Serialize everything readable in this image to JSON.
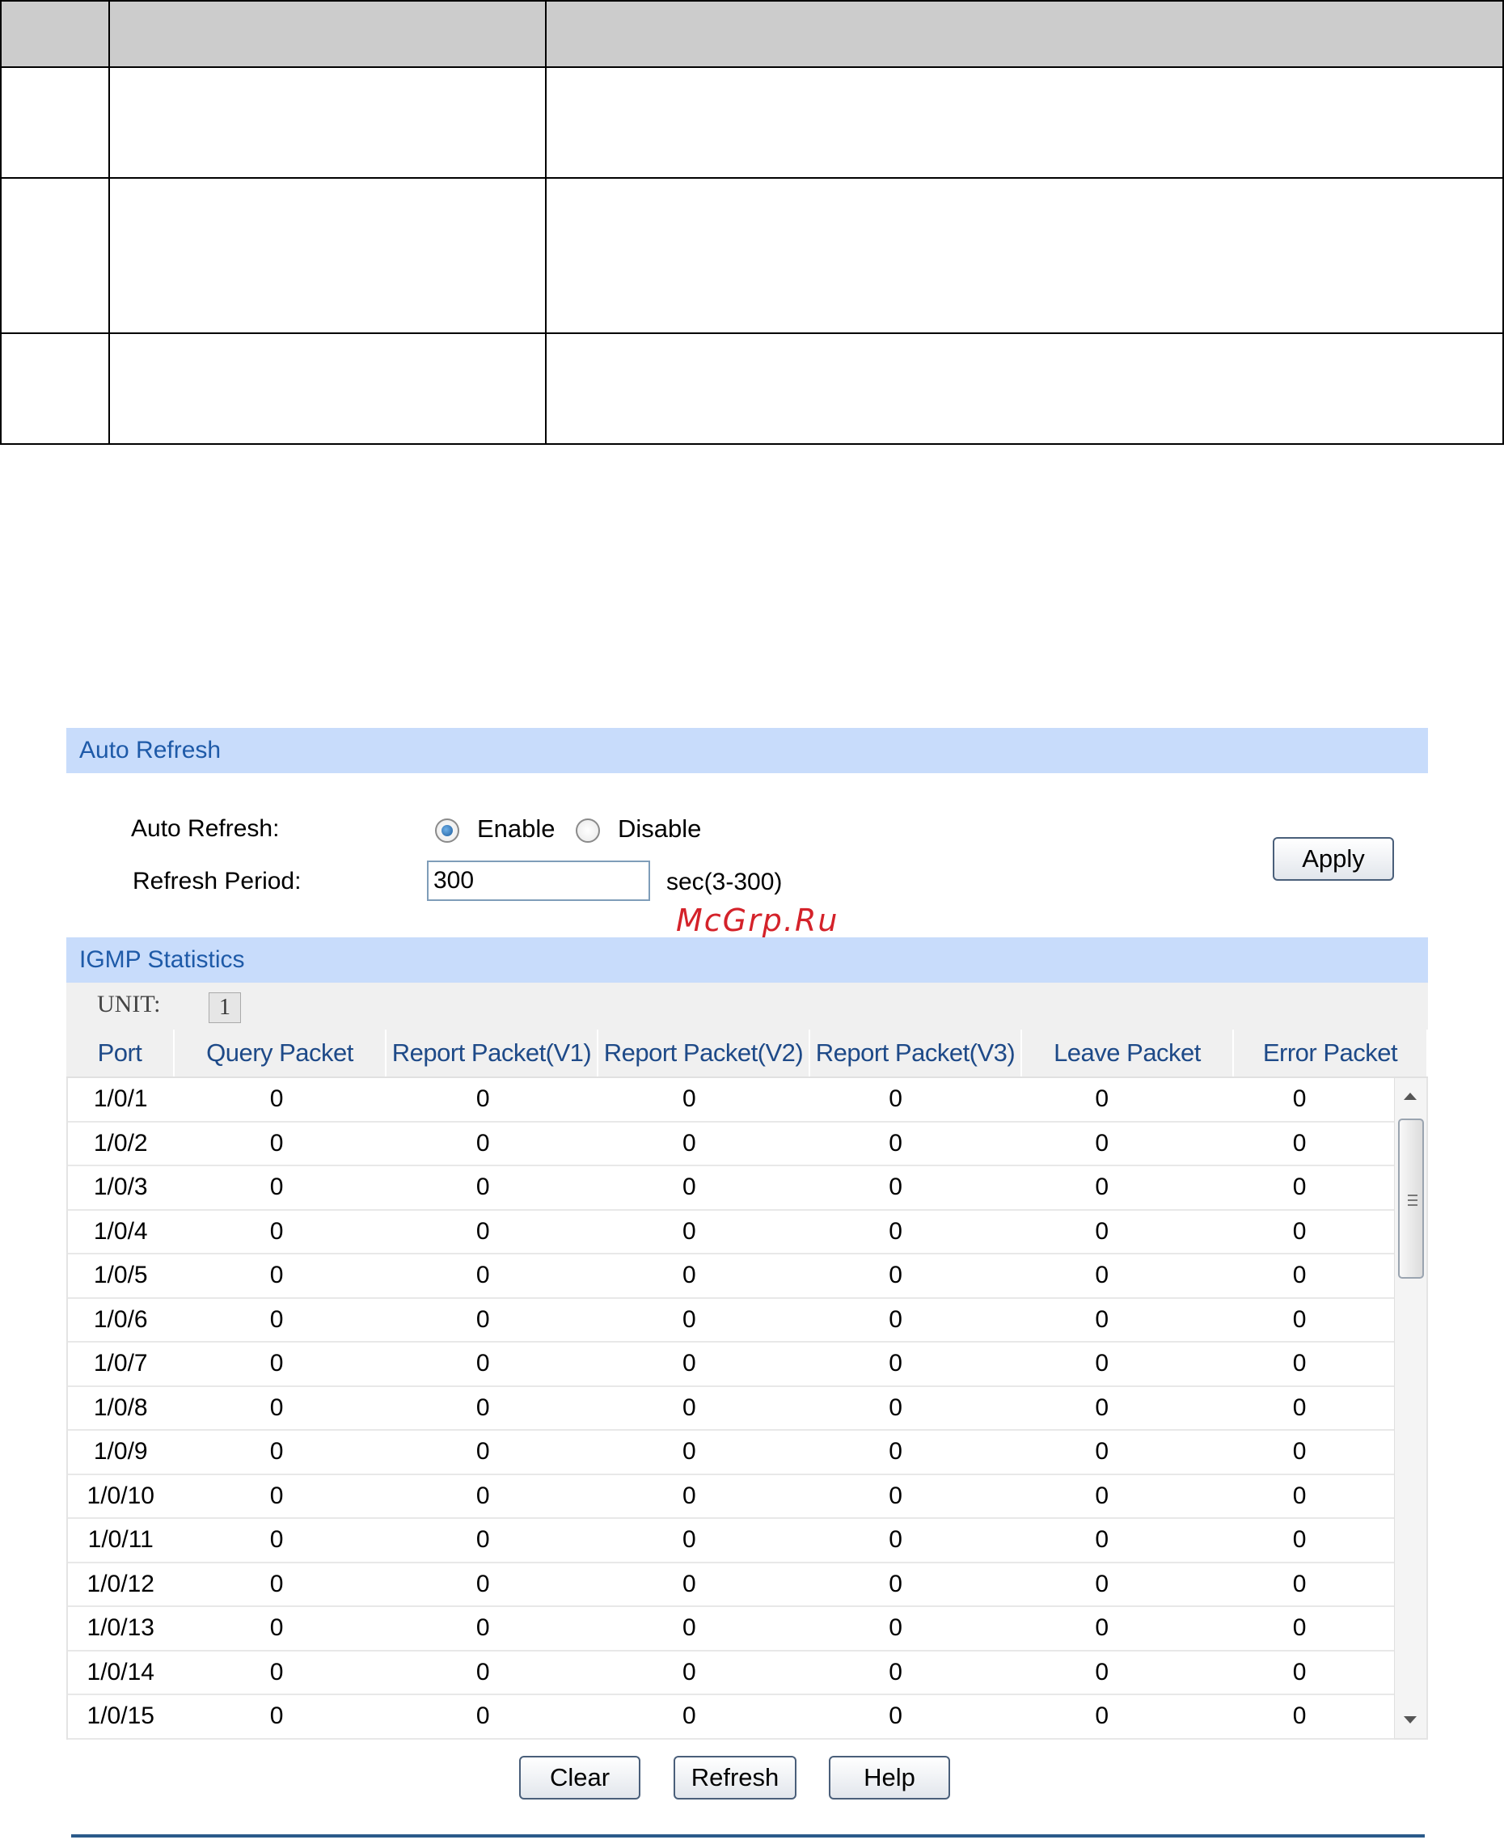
{
  "auto_refresh": {
    "section_title": "Auto Refresh",
    "auto_refresh_label": "Auto Refresh:",
    "enable_label": "Enable",
    "disable_label": "Disable",
    "enabled": true,
    "refresh_period_label": "Refresh Period:",
    "refresh_period_value": "300",
    "refresh_period_hint": "sec(3-300)",
    "apply_label": "Apply"
  },
  "watermark": "McGrp.Ru",
  "igmp": {
    "section_title": "IGMP Statistics",
    "unit_label": "UNIT:",
    "unit_value": "1",
    "columns": [
      "Port",
      "Query Packet",
      "Report Packet(V1)",
      "Report Packet(V2)",
      "Report Packet(V3)",
      "Leave Packet",
      "Error Packet"
    ],
    "rows": [
      {
        "port": "1/0/1",
        "query": "0",
        "v1": "0",
        "v2": "0",
        "v3": "0",
        "leave": "0",
        "error": "0"
      },
      {
        "port": "1/0/2",
        "query": "0",
        "v1": "0",
        "v2": "0",
        "v3": "0",
        "leave": "0",
        "error": "0"
      },
      {
        "port": "1/0/3",
        "query": "0",
        "v1": "0",
        "v2": "0",
        "v3": "0",
        "leave": "0",
        "error": "0"
      },
      {
        "port": "1/0/4",
        "query": "0",
        "v1": "0",
        "v2": "0",
        "v3": "0",
        "leave": "0",
        "error": "0"
      },
      {
        "port": "1/0/5",
        "query": "0",
        "v1": "0",
        "v2": "0",
        "v3": "0",
        "leave": "0",
        "error": "0"
      },
      {
        "port": "1/0/6",
        "query": "0",
        "v1": "0",
        "v2": "0",
        "v3": "0",
        "leave": "0",
        "error": "0"
      },
      {
        "port": "1/0/7",
        "query": "0",
        "v1": "0",
        "v2": "0",
        "v3": "0",
        "leave": "0",
        "error": "0"
      },
      {
        "port": "1/0/8",
        "query": "0",
        "v1": "0",
        "v2": "0",
        "v3": "0",
        "leave": "0",
        "error": "0"
      },
      {
        "port": "1/0/9",
        "query": "0",
        "v1": "0",
        "v2": "0",
        "v3": "0",
        "leave": "0",
        "error": "0"
      },
      {
        "port": "1/0/10",
        "query": "0",
        "v1": "0",
        "v2": "0",
        "v3": "0",
        "leave": "0",
        "error": "0"
      },
      {
        "port": "1/0/11",
        "query": "0",
        "v1": "0",
        "v2": "0",
        "v3": "0",
        "leave": "0",
        "error": "0"
      },
      {
        "port": "1/0/12",
        "query": "0",
        "v1": "0",
        "v2": "0",
        "v3": "0",
        "leave": "0",
        "error": "0"
      },
      {
        "port": "1/0/13",
        "query": "0",
        "v1": "0",
        "v2": "0",
        "v3": "0",
        "leave": "0",
        "error": "0"
      },
      {
        "port": "1/0/14",
        "query": "0",
        "v1": "0",
        "v2": "0",
        "v3": "0",
        "leave": "0",
        "error": "0"
      },
      {
        "port": "1/0/15",
        "query": "0",
        "v1": "0",
        "v2": "0",
        "v3": "0",
        "leave": "0",
        "error": "0"
      }
    ]
  },
  "actions": {
    "clear_label": "Clear",
    "refresh_label": "Refresh",
    "help_label": "Help"
  },
  "colors": {
    "section_bar": "#c8dcfb",
    "section_title": "#1e5aa8",
    "column_header_text": "#1e4a88",
    "watermark": "#d4222a"
  }
}
